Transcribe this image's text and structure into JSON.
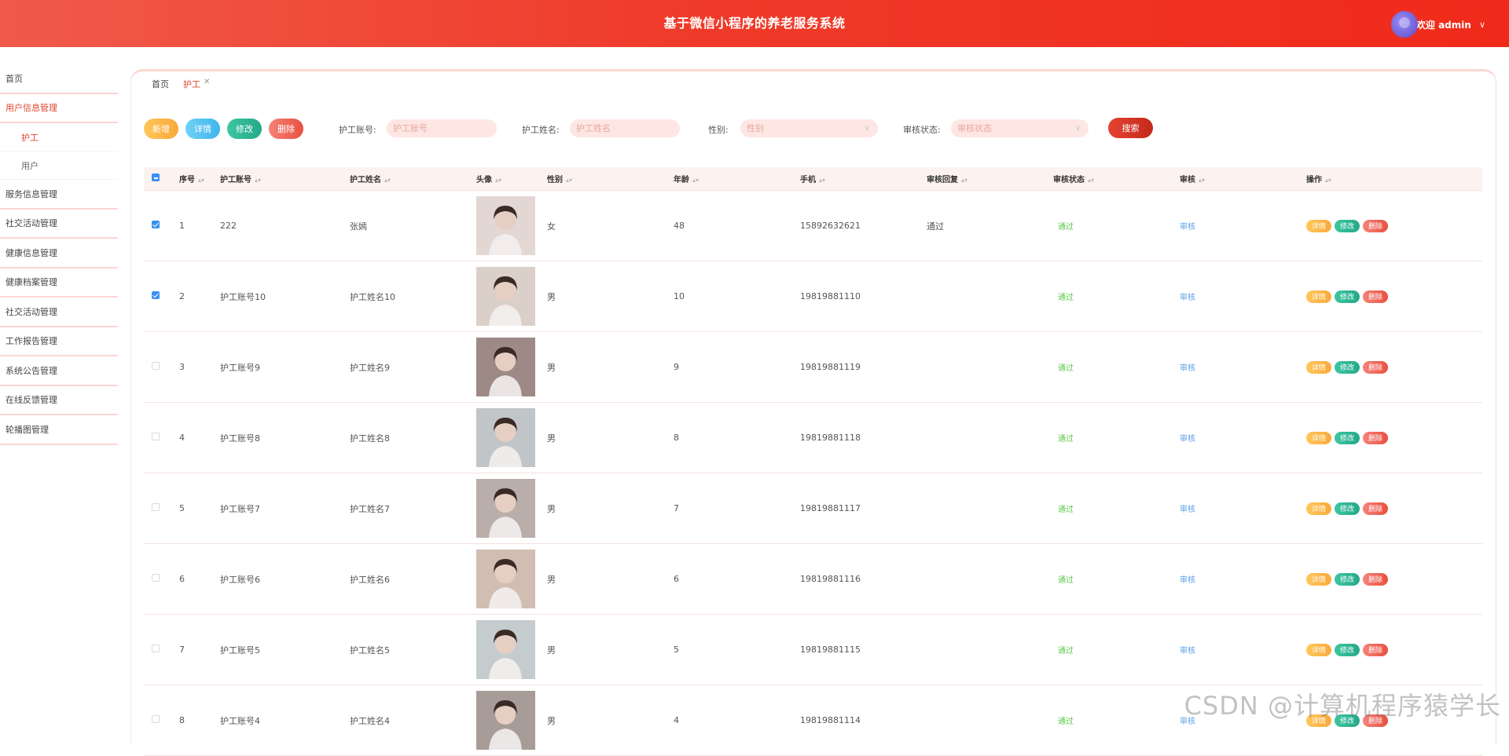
{
  "header": {
    "title": "基于微信小程序的养老服务系统",
    "welcome": "欢迎 admin"
  },
  "sidebar": {
    "items": [
      {
        "label": "首页"
      },
      {
        "label": "用户信息管理",
        "children": [
          {
            "label": "护工",
            "active": true
          },
          {
            "label": "用户"
          }
        ]
      },
      {
        "label": "服务信息管理"
      },
      {
        "label": "社交活动管理"
      },
      {
        "label": "健康信息管理"
      },
      {
        "label": "健康档案管理"
      },
      {
        "label": "社交活动管理"
      },
      {
        "label": "工作报告管理"
      },
      {
        "label": "系统公告管理"
      },
      {
        "label": "在线反馈管理"
      },
      {
        "label": "轮播图管理"
      }
    ]
  },
  "tabs": [
    {
      "label": "首页"
    },
    {
      "label": "护工",
      "active": true
    }
  ],
  "toolbar": {
    "add": "新增",
    "detail": "详情",
    "edit": "修改",
    "delete": "删除",
    "account_label": "护工账号:",
    "account_placeholder": "护工账号",
    "name_label": "护工姓名:",
    "name_placeholder": "护工姓名",
    "gender_label": "性别:",
    "gender_placeholder": "性别",
    "status_label": "审核状态:",
    "status_placeholder": "审核状态",
    "search": "搜索"
  },
  "table": {
    "columns": [
      "序号",
      "护工账号",
      "护工姓名",
      "头像",
      "性别",
      "年龄",
      "手机",
      "审核回复",
      "审核状态",
      "审核",
      "操作"
    ],
    "rows": [
      {
        "no": "1",
        "account": "222",
        "name": "张嫣",
        "gender": "女",
        "age": "48",
        "phone": "15892632621",
        "reply": "通过",
        "status": "通过",
        "review": "审核",
        "checked": true,
        "avatar_color": "#d9c9c4"
      },
      {
        "no": "2",
        "account": "护工账号10",
        "name": "护工姓名10",
        "gender": "男",
        "age": "10",
        "phone": "19819881110",
        "reply": "",
        "status": "通过",
        "review": "审核",
        "checked": true,
        "avatar_color": "#cbbbb0"
      },
      {
        "no": "3",
        "account": "护工账号9",
        "name": "护工姓名9",
        "gender": "男",
        "age": "9",
        "phone": "19819881119",
        "reply": "",
        "status": "通过",
        "review": "审核",
        "checked": false,
        "avatar_color": "#5a3a36"
      },
      {
        "no": "4",
        "account": "护工账号8",
        "name": "护工姓名8",
        "gender": "男",
        "age": "8",
        "phone": "19819881118",
        "reply": "",
        "status": "通过",
        "review": "审核",
        "checked": false,
        "avatar_color": "#9aa7ae"
      },
      {
        "no": "5",
        "account": "护工账号7",
        "name": "护工姓名7",
        "gender": "男",
        "age": "7",
        "phone": "19819881117",
        "reply": "",
        "status": "通过",
        "review": "审核",
        "checked": false,
        "avatar_color": "#8c7e78"
      },
      {
        "no": "6",
        "account": "护工账号6",
        "name": "护工姓名6",
        "gender": "男",
        "age": "6",
        "phone": "19819881116",
        "reply": "",
        "status": "通过",
        "review": "审核",
        "checked": false,
        "avatar_color": "#b69a88"
      },
      {
        "no": "7",
        "account": "护工账号5",
        "name": "护工姓名5",
        "gender": "男",
        "age": "5",
        "phone": "19819881115",
        "reply": "",
        "status": "通过",
        "review": "审核",
        "checked": false,
        "avatar_color": "#a3b4b9"
      },
      {
        "no": "8",
        "account": "护工账号4",
        "name": "护工姓名4",
        "gender": "男",
        "age": "4",
        "phone": "19819881114",
        "reply": "",
        "status": "通过",
        "review": "审核",
        "checked": false,
        "avatar_color": "#6b5c55"
      }
    ],
    "ops": {
      "detail": "详情",
      "edit": "修改",
      "delete": "删除"
    }
  },
  "watermark": "CSDN @计算机程序猿学长"
}
